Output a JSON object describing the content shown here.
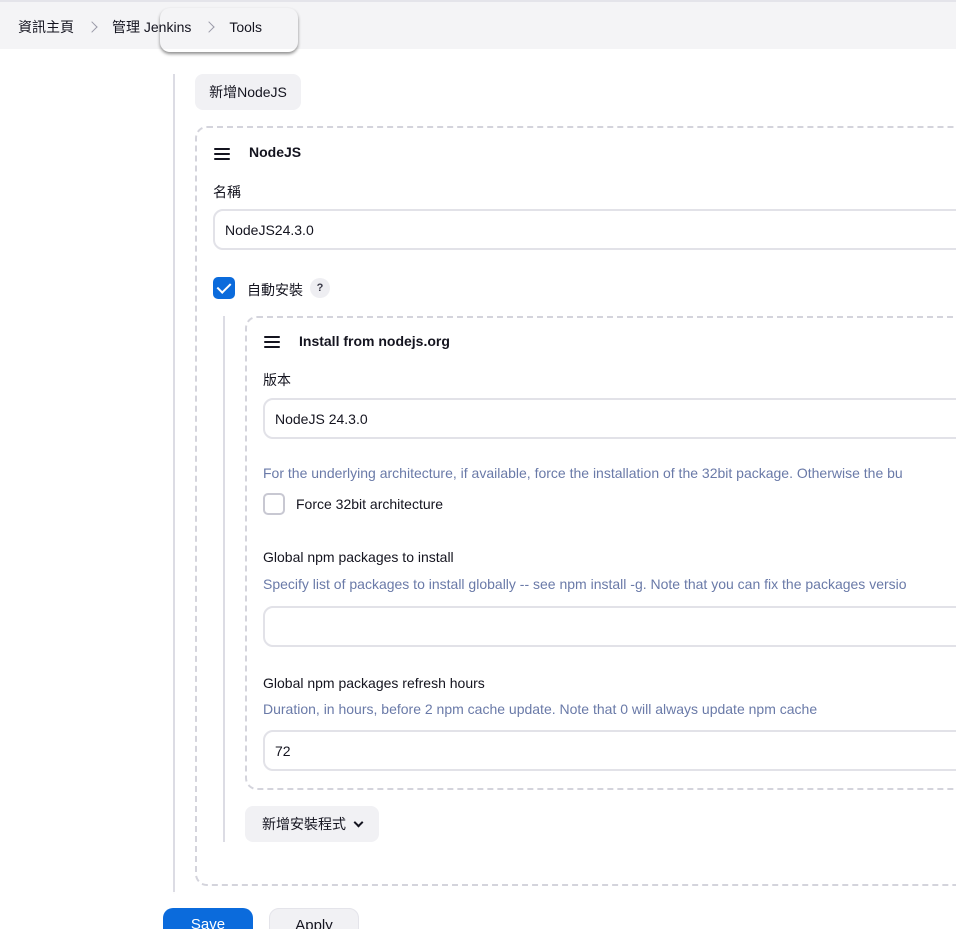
{
  "breadcrumb": {
    "home": "資訊主頁",
    "manage": "管理 Jenkins",
    "current": "Tools"
  },
  "add_nodejs_button": "新增NodeJS",
  "nodejs": {
    "title": "NodeJS",
    "name_label": "名稱",
    "name_value": "NodeJS24.3.0",
    "auto_install_label": "自動安裝",
    "auto_install_checked": true,
    "help_glyph": "?",
    "installer": {
      "title": "Install from nodejs.org",
      "version_label": "版本",
      "version_value": "NodeJS 24.3.0",
      "force32_desc": "For the underlying architecture, if available, force the installation of the 32bit package. Otherwise the bu",
      "force32_label": "Force 32bit architecture",
      "force32_checked": false,
      "npm_packages_label": "Global npm packages to install",
      "npm_packages_desc": "Specify list of packages to install globally -- see npm install -g. Note that you can fix the packages versio",
      "npm_packages_value": "",
      "refresh_label": "Global npm packages refresh hours",
      "refresh_desc": "Duration, in hours, before 2 npm cache update. Note that 0 will always update npm cache",
      "refresh_value": "72"
    },
    "add_installer_button": "新增安裝程式"
  },
  "footer": {
    "save": "Save",
    "apply": "Apply"
  },
  "colors": {
    "primary": "#0b6bdc",
    "description": "#6a7aa8",
    "header_bg": "#f4f4f6"
  },
  "icons": {
    "drag_handle": "drag-handle-icon",
    "breadcrumb_separator": "chevron-right-icon",
    "dropdown": "chevron-down-icon",
    "help": "help-icon"
  }
}
